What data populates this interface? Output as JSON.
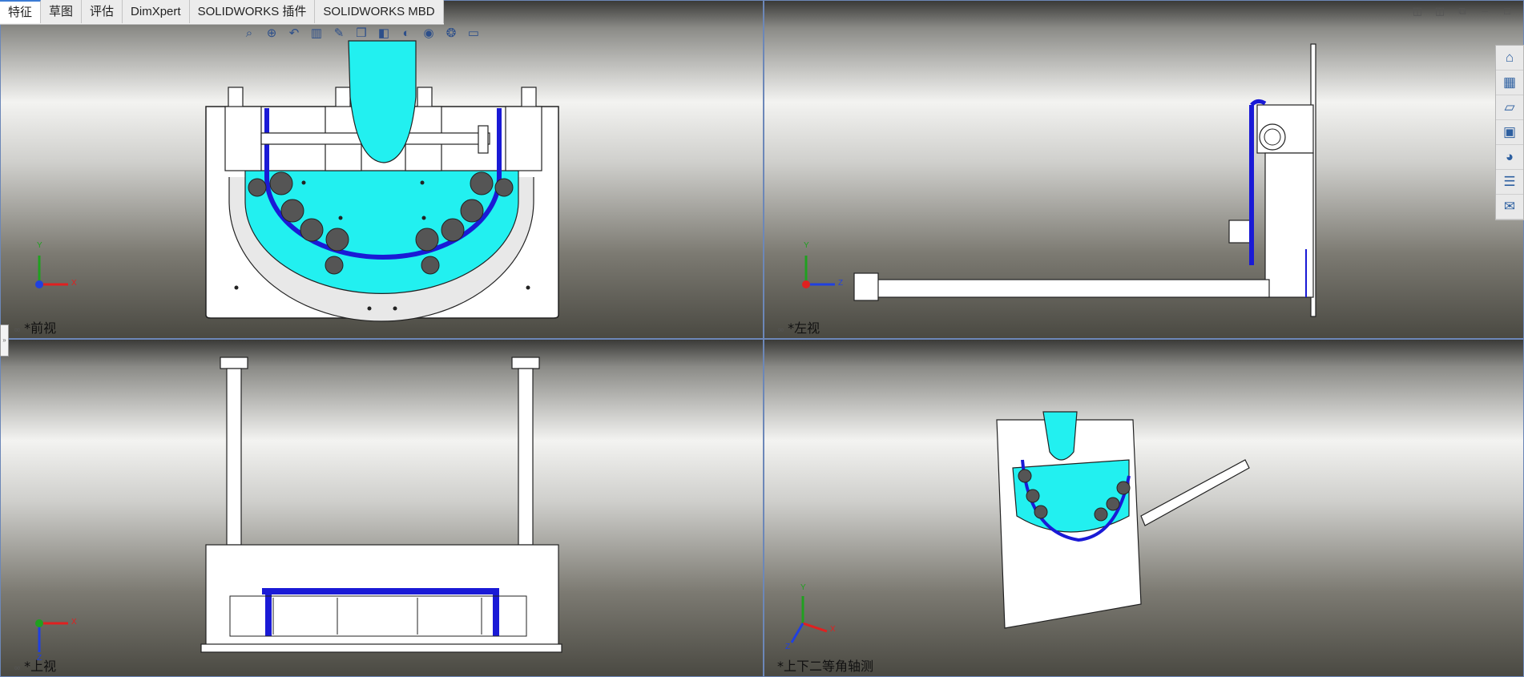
{
  "tabs": [
    {
      "label": "特征",
      "active": true
    },
    {
      "label": "草图"
    },
    {
      "label": "评估"
    },
    {
      "label": "DimXpert"
    },
    {
      "label": "SOLIDWORKS 插件"
    },
    {
      "label": "SOLIDWORKS MBD"
    }
  ],
  "heads_up_toolbar": [
    "zoom-to-fit-icon",
    "zoom-area-icon",
    "previous-view-icon",
    "section-view-icon",
    "dynamic-annotation-icon",
    "view-orientation-icon",
    "display-style-icon",
    "hide-show-icon",
    "edit-appearance-icon",
    "apply-scene-icon",
    "view-settings-icon"
  ],
  "window_controls": [
    "tile-left-icon",
    "tile-right-icon",
    "restore-icon",
    "minimize-icon",
    "maximize-icon"
  ],
  "task_pane": [
    "home-icon",
    "design-library-icon",
    "file-explorer-icon",
    "view-palette-icon",
    "appearances-icon",
    "custom-properties-icon",
    "forum-icon"
  ],
  "viewports": [
    {
      "label": "*前视",
      "axes": [
        "X",
        "Y"
      ]
    },
    {
      "label": "*左视",
      "axes": [
        "Z",
        "Y"
      ]
    },
    {
      "label": "*上视",
      "axes": [
        "X",
        "Z"
      ]
    },
    {
      "label": "*上下二等角轴测",
      "axes": [
        "X",
        "Y",
        "Z"
      ]
    }
  ],
  "colors": {
    "accent": "#00ffff",
    "belt": "#1a1ad6",
    "roller": "#555555",
    "frame": "#ffffff",
    "axis_x": "#e02020",
    "axis_y": "#20a020",
    "axis_z": "#2040e0"
  }
}
